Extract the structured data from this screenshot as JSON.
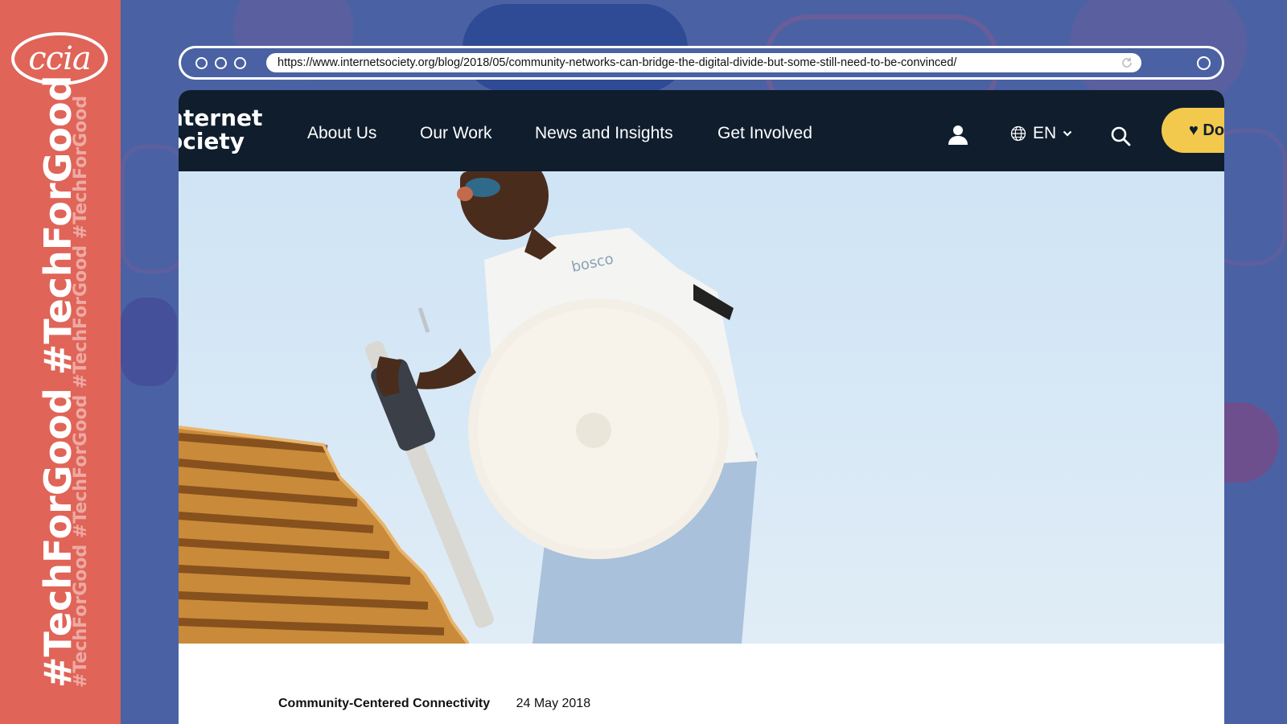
{
  "sidebar": {
    "logo_text": "ccia",
    "hashtag_primary": "#TechForGood #TechForGood",
    "hashtag_secondary": "#TechForGood #TechForGood #TechForGood #TechForGood"
  },
  "browser": {
    "url": "https://www.internetsociety.org/blog/2018/05/community-networks-can-bridge-the-digital-divide-but-some-still-need-to-be-convinced/"
  },
  "site": {
    "brand_line1": "nternet",
    "brand_line2": "ociety",
    "nav": [
      "About Us",
      "Our Work",
      "News and Insights",
      "Get Involved"
    ],
    "language": "EN",
    "donate_label": "♥ Do",
    "hero_shirt_text": "bosco",
    "article": {
      "category": "Community-Centered Connectivity",
      "date": "24 May 2018"
    }
  },
  "colors": {
    "sidebar": "#e06458",
    "background": "#4a62a3",
    "nav_bg": "#0f1d2d",
    "donate": "#f2c94c"
  },
  "icons": [
    "reload-icon",
    "user-icon",
    "globe-icon",
    "chevron-down-icon",
    "search-icon",
    "heart-icon"
  ]
}
